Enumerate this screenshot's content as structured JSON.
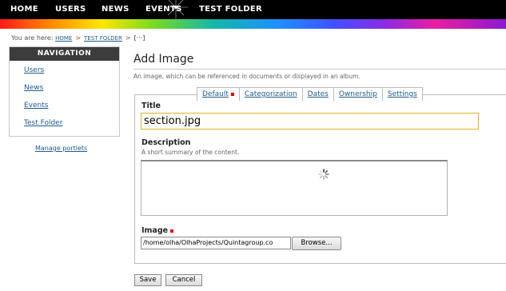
{
  "topnav": {
    "items": [
      "HOME",
      "USERS",
      "NEWS",
      "EVENTS",
      "TEST FOLDER"
    ]
  },
  "breadcrumb": {
    "prefix": "You are here:",
    "items": [
      "HOME",
      "TEST FOLDER"
    ],
    "current": "[···]"
  },
  "navigation": {
    "title": "NAVIGATION",
    "items": [
      "Users",
      "News",
      "Events",
      "Test Folder"
    ],
    "manage": "Manage portlets"
  },
  "page": {
    "title": "Add Image",
    "description": "An image, which can be referenced in documents or displayed in an album."
  },
  "tabs": [
    {
      "label": "Default",
      "required": true
    },
    {
      "label": "Categorization",
      "required": false
    },
    {
      "label": "Dates",
      "required": false
    },
    {
      "label": "Ownership",
      "required": false
    },
    {
      "label": "Settings",
      "required": false
    }
  ],
  "form": {
    "title_label": "Title",
    "title_value": "section.jpg",
    "description_label": "Description",
    "description_help": "A short summary of the content.",
    "image_label": "Image",
    "image_value": "/home/olha/OlhaProjects/Quintagroup.co",
    "browse_label": "Browse..."
  },
  "buttons": {
    "save": "Save",
    "cancel": "Cancel"
  },
  "colors": {
    "link": "#205c90",
    "required": "#e00000",
    "topbar": "#000000",
    "input_focus_border": "#e0b030"
  }
}
